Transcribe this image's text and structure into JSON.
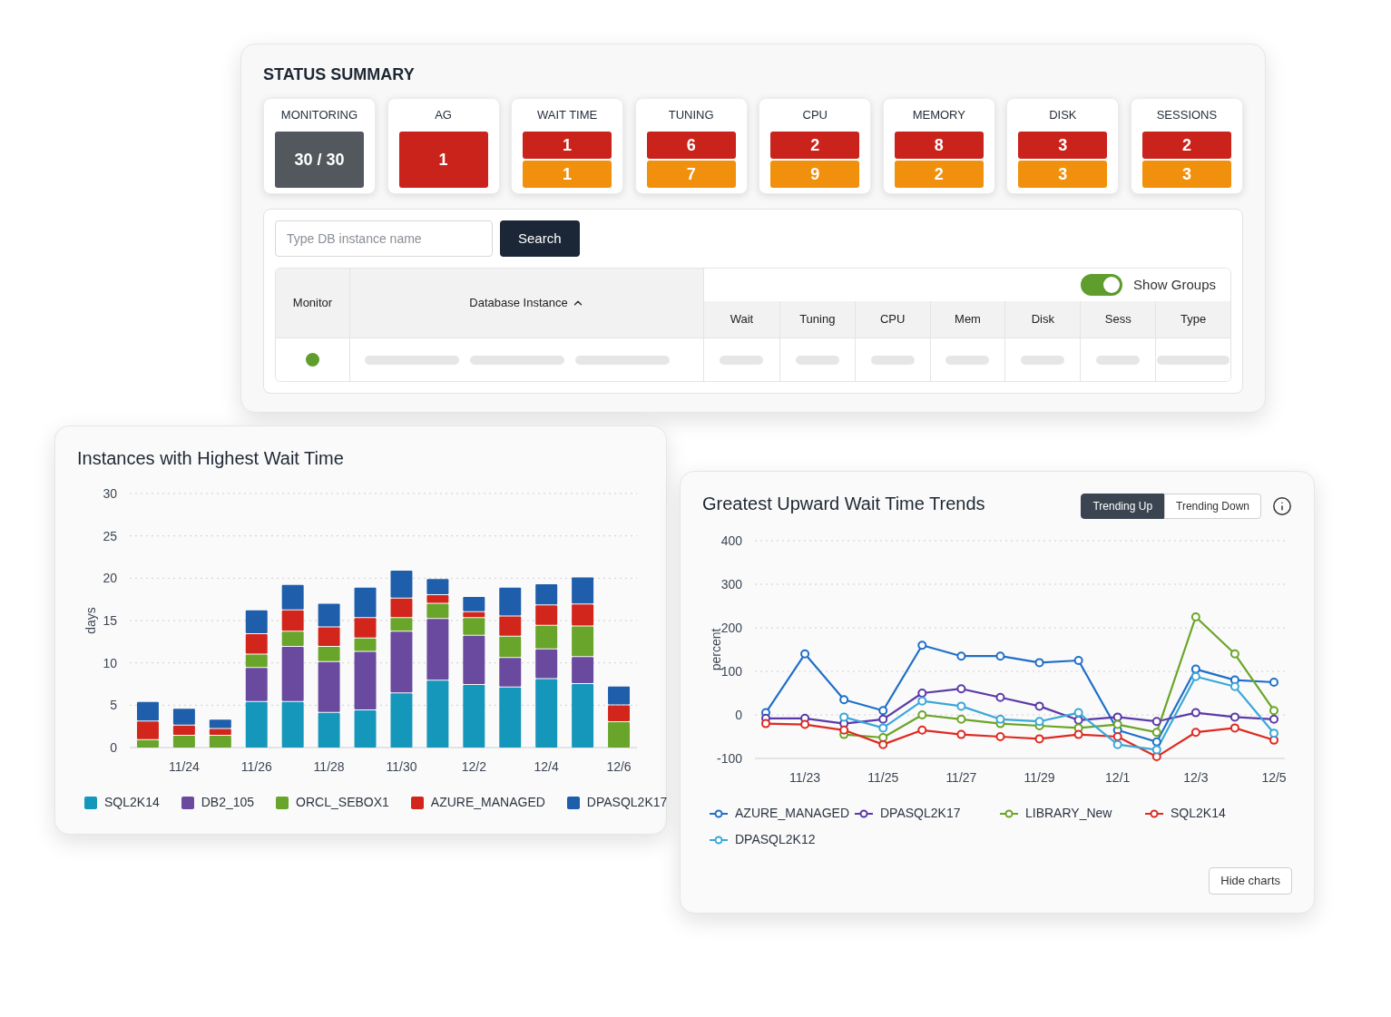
{
  "status_summary": {
    "title": "STATUS SUMMARY",
    "tiles": [
      {
        "label": "MONITORING",
        "counts": [
          {
            "text": "30 / 30",
            "color": "#53585e"
          }
        ]
      },
      {
        "label": "AG",
        "counts": [
          {
            "text": "1",
            "color": "#c9231b"
          }
        ]
      },
      {
        "label": "WAIT TIME",
        "counts": [
          {
            "text": "1",
            "color": "#c9231b"
          },
          {
            "text": "1",
            "color": "#f0900c"
          }
        ]
      },
      {
        "label": "TUNING",
        "counts": [
          {
            "text": "6",
            "color": "#c9231b"
          },
          {
            "text": "7",
            "color": "#f0900c"
          }
        ]
      },
      {
        "label": "CPU",
        "counts": [
          {
            "text": "2",
            "color": "#c9231b"
          },
          {
            "text": "9",
            "color": "#f0900c"
          }
        ]
      },
      {
        "label": "MEMORY",
        "counts": [
          {
            "text": "8",
            "color": "#c9231b"
          },
          {
            "text": "2",
            "color": "#f0900c"
          }
        ]
      },
      {
        "label": "DISK",
        "counts": [
          {
            "text": "3",
            "color": "#c9231b"
          },
          {
            "text": "3",
            "color": "#f0900c"
          }
        ]
      },
      {
        "label": "SESSIONS",
        "counts": [
          {
            "text": "2",
            "color": "#c9231b"
          },
          {
            "text": "3",
            "color": "#f0900c"
          }
        ]
      }
    ]
  },
  "search": {
    "placeholder": "Type DB instance name",
    "button": "Search"
  },
  "show_groups": {
    "label": "Show Groups",
    "on": true
  },
  "table": {
    "columns": [
      {
        "label": "Monitor",
        "sorted": false
      },
      {
        "label": "Database Instance",
        "sorted": true
      },
      {
        "label": "Wait",
        "sorted": false
      },
      {
        "label": "Tuning",
        "sorted": false
      },
      {
        "label": "CPU",
        "sorted": false
      },
      {
        "label": "Mem",
        "sorted": false
      },
      {
        "label": "Disk",
        "sorted": false
      },
      {
        "label": "Sess",
        "sorted": false
      },
      {
        "label": "Type",
        "sorted": false
      }
    ],
    "rows": [
      {
        "color": "#5f9e2c",
        "loading": true
      }
    ]
  },
  "wait_time_chart": {
    "chart_data": {
      "type": "bar",
      "title": "Instances with Highest Wait Time",
      "ylabel": "days",
      "stacked": true,
      "grid": true,
      "categories": [
        null,
        "11/24",
        null,
        "11/26",
        null,
        "11/28",
        null,
        "11/30",
        null,
        "12/2",
        null,
        "12/4",
        null,
        "12/6"
      ],
      "ylim": [
        0,
        30
      ],
      "yticks": [
        0,
        5,
        10,
        15,
        20,
        25,
        30
      ],
      "series": [
        {
          "name": "SQL2K14",
          "color": "#1596bb",
          "values": [
            0,
            0,
            0,
            5.5,
            5.5,
            4.2,
            4.5,
            6.5,
            8,
            7.5,
            7.2,
            8.2,
            7.6,
            0
          ]
        },
        {
          "name": "DB2_105",
          "color": "#6a4a9f",
          "values": [
            0,
            0,
            0,
            4,
            6.5,
            6,
            6.9,
            7.3,
            7.3,
            5.8,
            3.5,
            3.5,
            3.2,
            0
          ]
        },
        {
          "name": "ORCL_SEBOX1",
          "color": "#69a52a",
          "values": [
            1,
            1.5,
            1.5,
            1.6,
            1.8,
            1.8,
            1.6,
            1.6,
            1.8,
            2.1,
            2.5,
            2.8,
            3.6,
            3.1
          ]
        },
        {
          "name": "AZURE_MANAGED",
          "color": "#d2261c",
          "values": [
            2.2,
            1.2,
            0.8,
            2.4,
            2.5,
            2.3,
            2.4,
            2.3,
            1,
            0.7,
            2.4,
            2.4,
            2.6,
            2
          ]
        },
        {
          "name": "DPASQL2K17",
          "color": "#1e5eab",
          "values": [
            2.3,
            2,
            1.1,
            2.8,
            3,
            2.8,
            3.6,
            3.3,
            1.9,
            1.8,
            3.4,
            2.5,
            3.2,
            2.2
          ]
        }
      ]
    }
  },
  "trend_chart": {
    "tabs": [
      {
        "label": "Trending Up",
        "selected": true
      },
      {
        "label": "Trending Down",
        "selected": false
      }
    ],
    "chart_data": {
      "type": "line",
      "title": "Greatest Upward Wait Time Trends",
      "ylabel": "percent",
      "grid": true,
      "categories": [
        null,
        "11/23",
        null,
        "11/25",
        null,
        "11/27",
        null,
        "11/29",
        null,
        "12/1",
        null,
        "12/3",
        null,
        "12/5"
      ],
      "ylim": [
        -100,
        400
      ],
      "yticks": [
        -100,
        0,
        100,
        200,
        300,
        400
      ],
      "series": [
        {
          "name": "AZURE_MANAGED",
          "color": "#1f6fc8",
          "marker": "circle",
          "values": [
            5,
            140,
            35,
            10,
            160,
            135,
            135,
            120,
            125,
            -35,
            -62,
            105,
            80,
            75
          ]
        },
        {
          "name": "DPASQL2K17",
          "color": "#5b3aa8",
          "marker": "circle",
          "values": [
            -8,
            -8,
            -20,
            -10,
            50,
            60,
            40,
            20,
            -12,
            -5,
            -15,
            5,
            -5,
            -10
          ]
        },
        {
          "name": "LIBRARY_New",
          "color": "#6aa527",
          "marker": "circle",
          "values": [
            null,
            null,
            -45,
            -52,
            0,
            -10,
            -20,
            -25,
            -30,
            -22,
            -40,
            225,
            140,
            10
          ]
        },
        {
          "name": "SQL2K14",
          "color": "#de2a22",
          "marker": "circle",
          "values": [
            -20,
            -22,
            -35,
            -68,
            -35,
            -45,
            -50,
            -55,
            -45,
            -50,
            -96,
            -40,
            -30,
            -58
          ]
        },
        {
          "name": "DPASQL2K12",
          "color": "#3aa8d8",
          "marker": "circle",
          "values": [
            null,
            null,
            -5,
            -30,
            32,
            20,
            -10,
            -15,
            5,
            -68,
            -80,
            88,
            65,
            -42
          ]
        }
      ]
    },
    "button": "Hide charts"
  }
}
